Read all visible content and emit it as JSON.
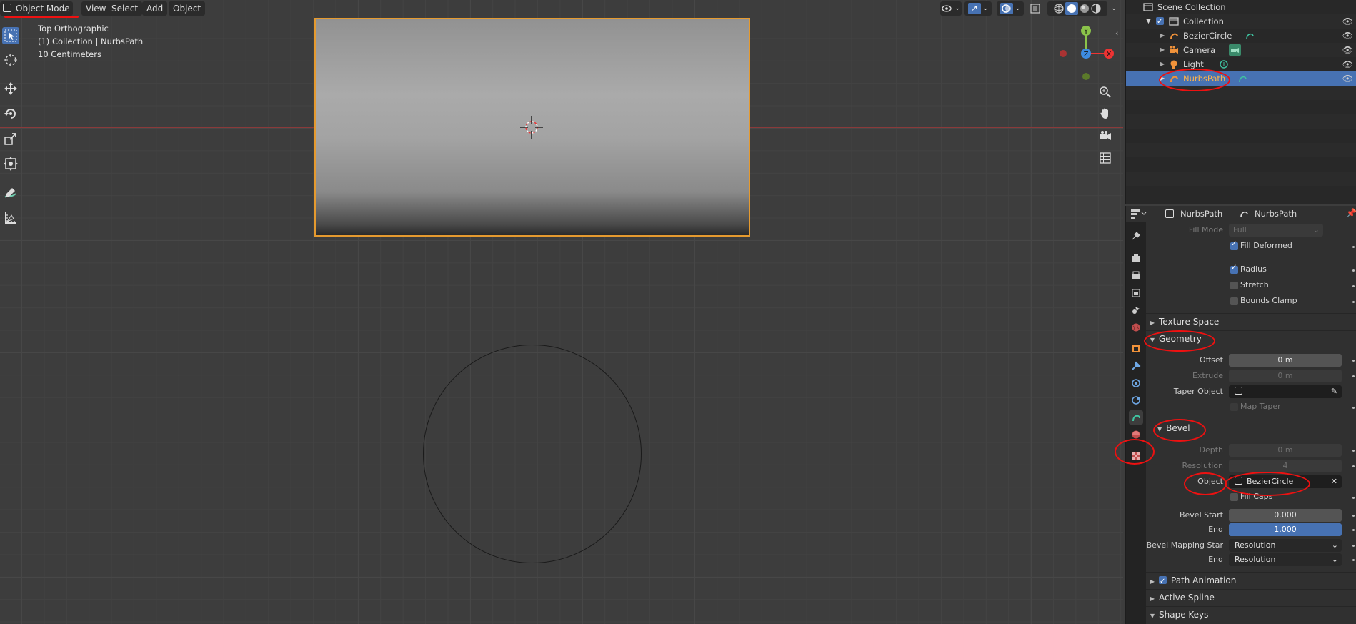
{
  "header": {
    "mode": "Object Mode",
    "menus": [
      "View",
      "Select",
      "Add",
      "Object"
    ]
  },
  "hud": {
    "view_name": "Top Orthographic",
    "collection": "(1) Collection | NurbsPath",
    "scale": "10 Centimeters"
  },
  "gizmo": {
    "y": "Y",
    "x": "X",
    "z": "Z"
  },
  "outliner": {
    "scene_collection": "Scene Collection",
    "collection": "Collection",
    "items": [
      {
        "label": "BezierCircle"
      },
      {
        "label": "Camera"
      },
      {
        "label": "Light"
      },
      {
        "label": "NurbsPath"
      }
    ]
  },
  "properties": {
    "object_name": "NurbsPath",
    "data_name": "NurbsPath",
    "fill_mode_label": "Fill Mode",
    "fill_mode_value": "Full",
    "fill_deformed": "Fill Deformed",
    "radius": "Radius",
    "stretch": "Stretch",
    "bounds_clamp": "Bounds Clamp",
    "texture_space": "Texture Space",
    "geometry": "Geometry",
    "offset_label": "Offset",
    "offset_value": "0 m",
    "extrude_label": "Extrude",
    "extrude_value": "0 m",
    "taper_label": "Taper Object",
    "map_taper": "Map Taper",
    "bevel": "Bevel",
    "depth_label": "Depth",
    "depth_value": "0 m",
    "resolution_label": "Resolution",
    "resolution_value": "4",
    "object_label": "Object",
    "object_value": "BezierCircle",
    "fill_caps": "Fill Caps",
    "bevel_start_label": "Bevel Start",
    "bevel_start_value": "0.000",
    "end_label": "End",
    "end_value": "1.000",
    "mapping_start_label": "Bevel Mapping Star",
    "mapping_start_value": "Resolution",
    "mapping_end_label": "End",
    "mapping_end_value": "Resolution",
    "path_animation": "Path Animation",
    "active_spline": "Active Spline",
    "shape_keys": "Shape Keys"
  },
  "colors": {
    "accent": "#4772b3",
    "selection_outline": "#e59a2f",
    "annotation": "#ee1111"
  }
}
